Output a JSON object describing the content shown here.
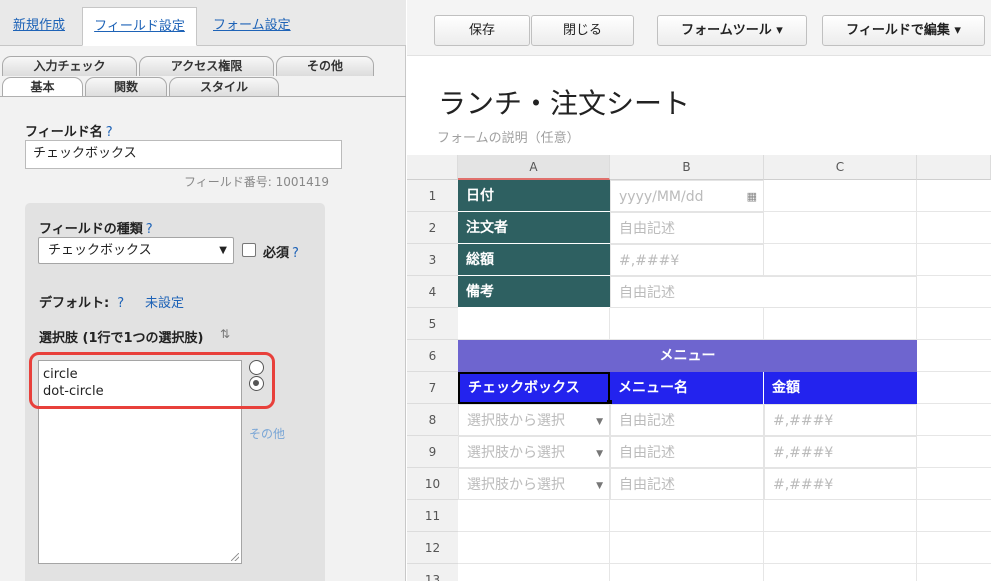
{
  "left": {
    "top_tabs": [
      "新規作成",
      "フィールド設定",
      "フォーム設定"
    ],
    "sub_tabs_row1": [
      "入力チェック",
      "アクセス権限",
      "その他"
    ],
    "sub_tabs_row2": [
      "基本",
      "関数",
      "スタイル"
    ],
    "field_name_label": "フィールド名",
    "help_mark": "?",
    "field_name_value": "チェックボックス",
    "field_number": "フィールド番号: 1001419",
    "field_type_label": "フィールドの種類",
    "field_type_value": "チェックボックス",
    "required_label": "必須",
    "default_label": "デフォルト:",
    "default_value": "未設定",
    "choices_label": "選択肢 (1行で1つの選択肢)",
    "sort_icon": "sort-icon",
    "choices": [
      "circle",
      "dot-circle"
    ],
    "other_link": "その他",
    "highlight_color": "#e8403b"
  },
  "toolbar": {
    "save": "保存",
    "close": "閉じる",
    "form_tool": "フォームツール ▾",
    "edit_field": "フィールドで編集 ▾"
  },
  "sheet": {
    "title": "ランチ・注文シート",
    "description": "フォームの説明（任意）",
    "columns": [
      "A",
      "B",
      "C"
    ],
    "rows": [
      "1",
      "2",
      "3",
      "4",
      "5",
      "6",
      "7",
      "8",
      "9",
      "10",
      "11",
      "12",
      "13"
    ],
    "labels": {
      "date": "日付",
      "orderer": "注文者",
      "total": "総額",
      "memo": "備考"
    },
    "inputs": {
      "date": "yyyy/MM/dd",
      "orderer": "自由記述",
      "total": "#,###¥",
      "memo": "自由記述"
    },
    "menu_header": "メニュー",
    "menu_columns": [
      "チェックボックス",
      "メニュー名",
      "金額"
    ],
    "menu_row_placeholders": {
      "choice": "選択肢から選択",
      "name": "自由記述",
      "price": "#,###¥"
    },
    "colors": {
      "label_green": "#2e6061",
      "menu_purple": "#6e65cf",
      "menu_blue": "#2323ee"
    }
  }
}
